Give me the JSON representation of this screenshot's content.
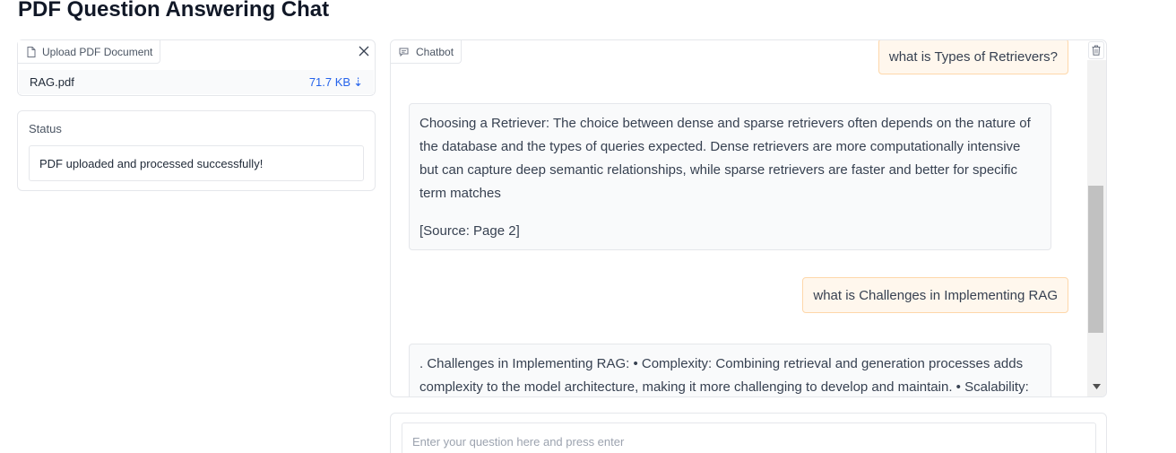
{
  "page": {
    "title": "PDF Question Answering Chat"
  },
  "upload": {
    "label": "Upload PDF Document",
    "file_name": "RAG.pdf",
    "file_size": "71.7 KB",
    "download_glyph": "⇣",
    "icons": {
      "label": "file-icon",
      "close": "close-icon",
      "download": "download-icon"
    }
  },
  "status": {
    "label": "Status",
    "value": "PDF uploaded and processed successfully!"
  },
  "chat": {
    "label": "Chatbot",
    "icons": {
      "label": "chat-bubble-icon",
      "clear": "trash-icon",
      "scroll": "chevron-down-icon"
    },
    "messages": [
      {
        "role": "user",
        "text": "what is Types of Retrievers?"
      },
      {
        "role": "bot",
        "text": "Choosing a Retriever: The choice between dense and sparse retrievers often depends on the nature of the database and the types of queries expected. Dense retrievers are more computationally intensive but can capture deep semantic relationships, while sparse retrievers are faster and better for specific term matches",
        "source": "[Source: Page 2]"
      },
      {
        "role": "user",
        "text": "what is Challenges in Implementing RAG"
      },
      {
        "role": "bot",
        "text": ". Challenges in Implementing RAG: • Complexity: Combining retrieval and generation processes adds complexity to the model architecture, making it more challenging to develop and maintain. • Scalability:"
      }
    ]
  },
  "input": {
    "placeholder": "Enter your question here and press enter",
    "value": ""
  },
  "colors": {
    "user_bubble_bg": "#fff7ed",
    "user_bubble_border": "#fed7aa",
    "link": "#2563eb",
    "bot_bubble_bg": "#f9fafb"
  }
}
